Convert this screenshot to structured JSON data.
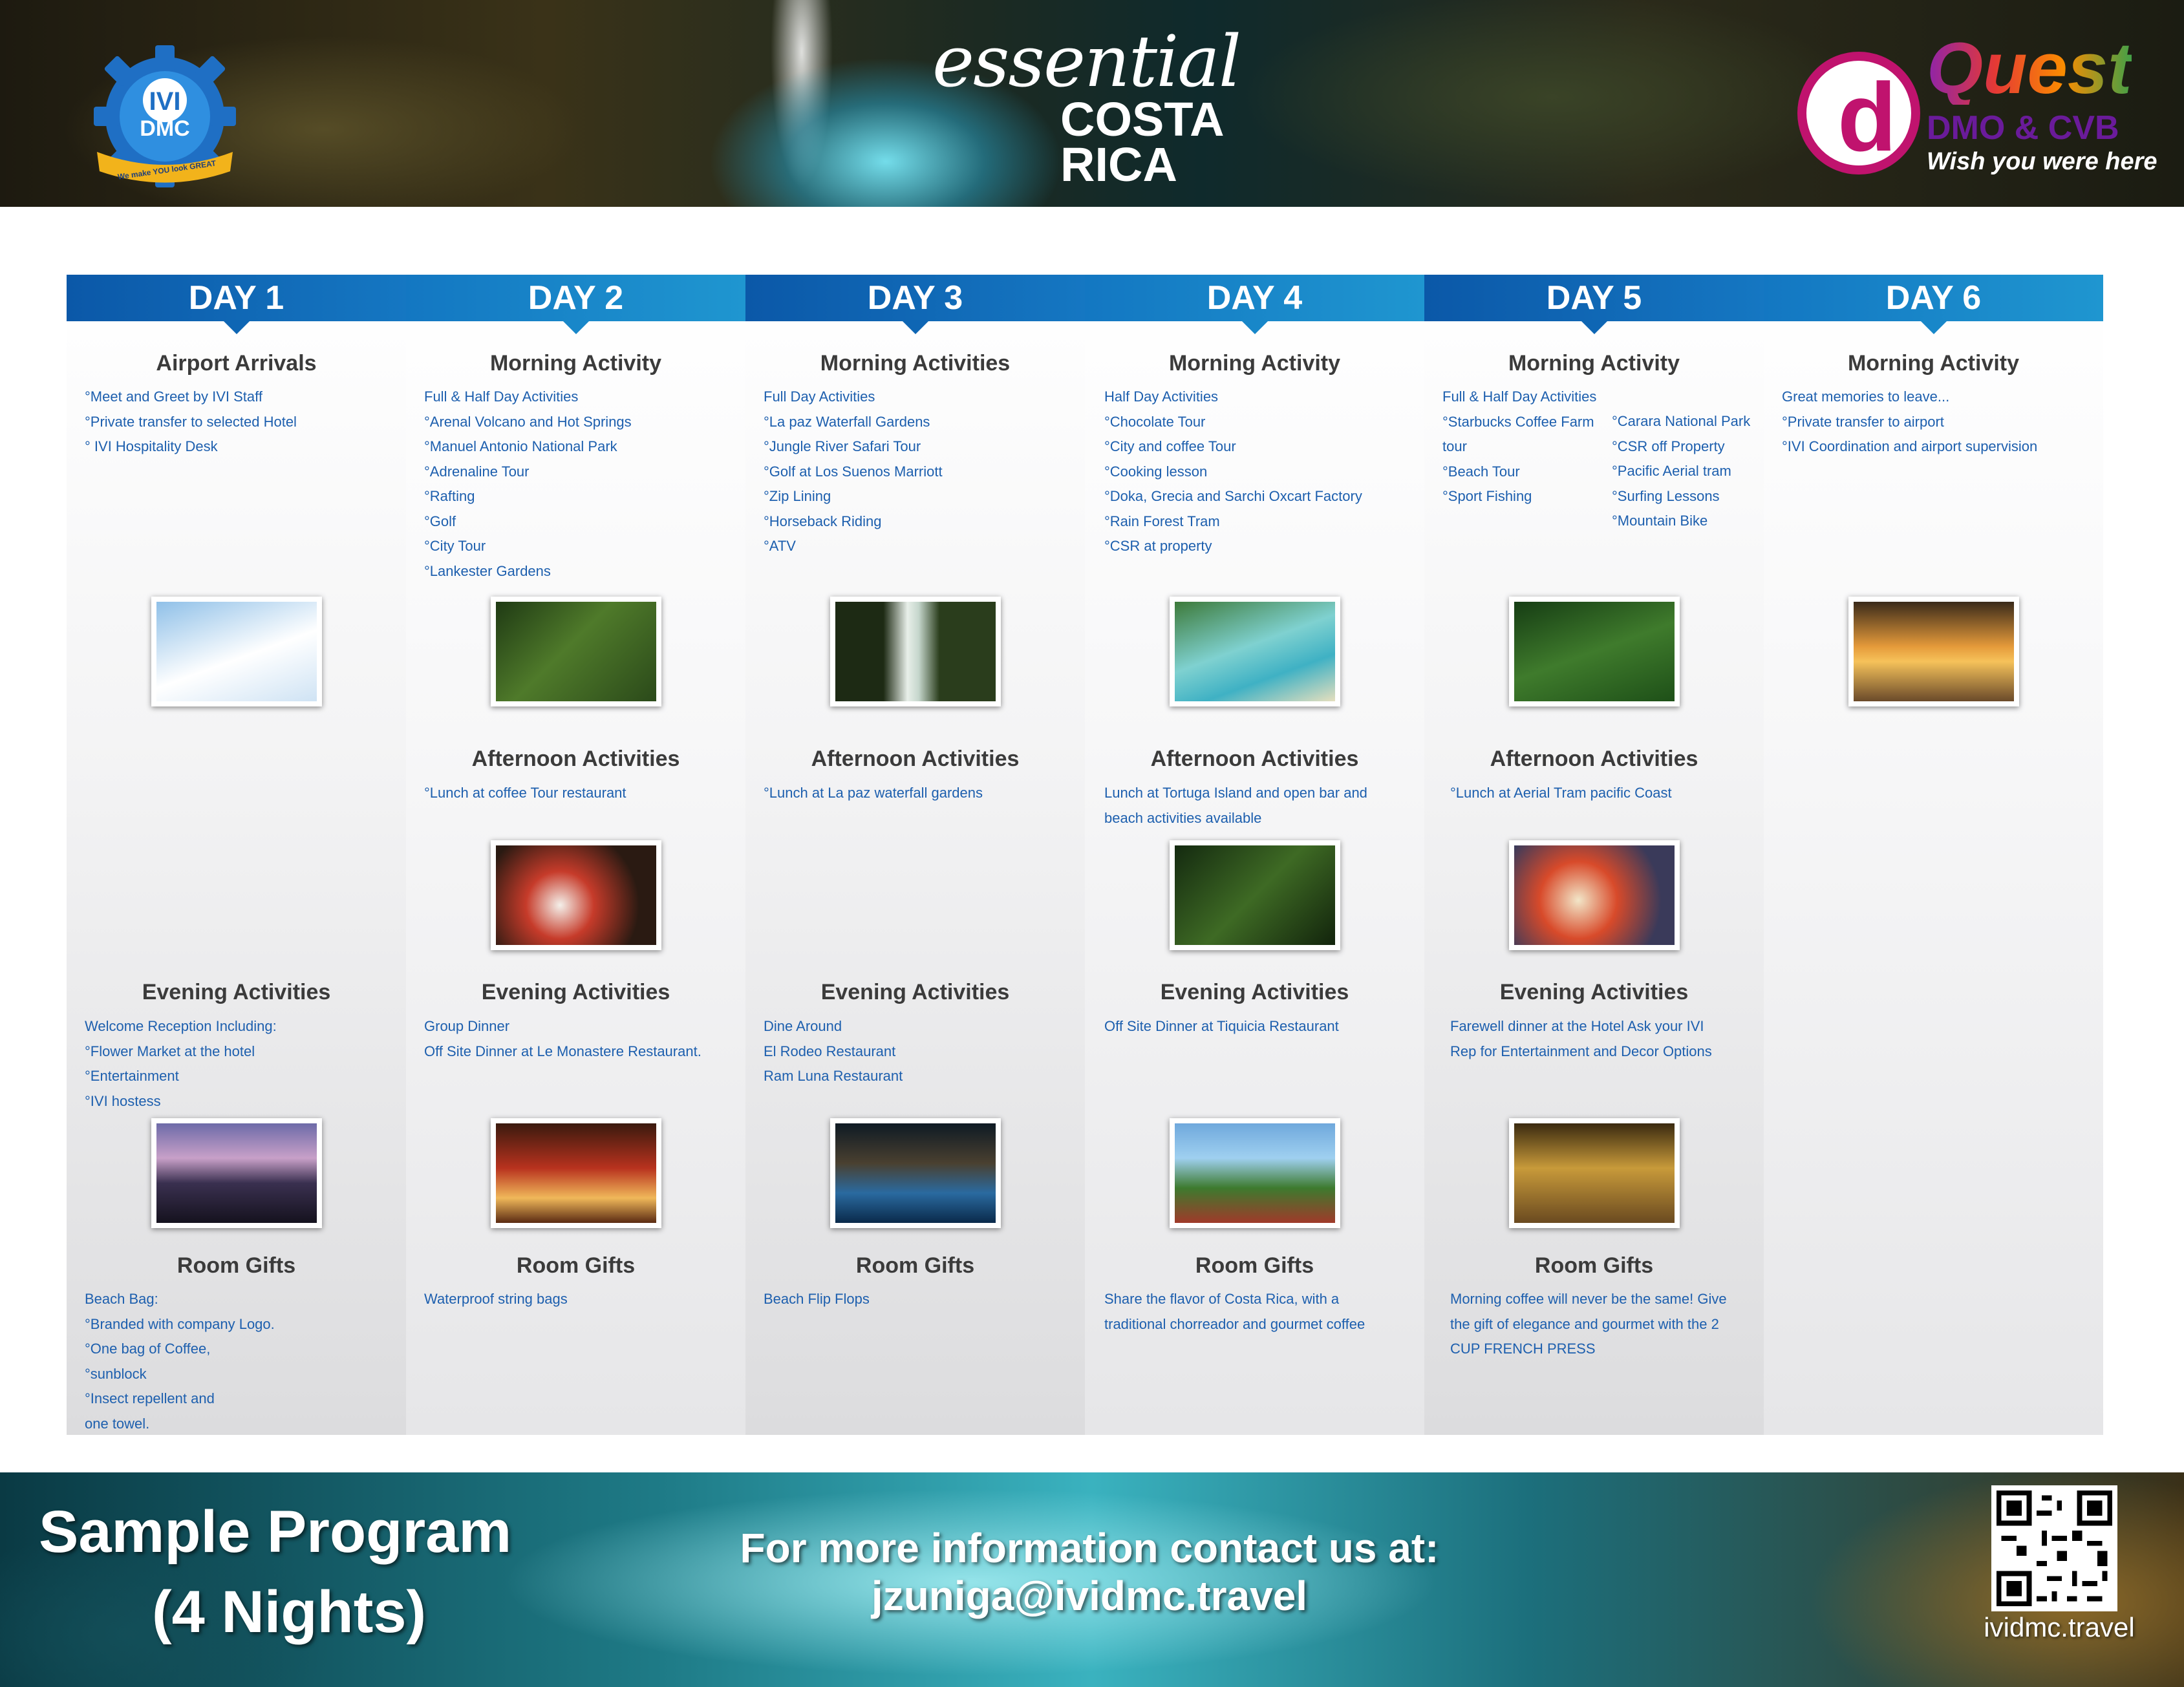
{
  "header": {
    "ivi_logo": {
      "name": "DMC",
      "tagline": "We make YOU look GREAT"
    },
    "brand": {
      "script": "essential",
      "line1": "COSTA",
      "line2": "RICA"
    },
    "quest_logo": {
      "word": "Quest",
      "sub": "DMO & CVB",
      "tagline": "Wish you were here"
    }
  },
  "colors": {
    "day_blue_dark": "#0b58a8",
    "day_blue_light": "#1f96d0",
    "item_text": "#1d5fae",
    "section_title": "#3b3b3b"
  },
  "days": [
    {
      "label": "DAY 1",
      "morning_title": "Airport Arrivals",
      "morning_items": [
        "°Meet and Greet by IVI Staff",
        "°Private transfer to selected Hotel",
        "° IVI Hospitality Desk"
      ],
      "morning_photo": "airplane-in-clouds",
      "afternoon_title": "",
      "afternoon_items": [],
      "afternoon_photo": "",
      "evening_title": "Evening Activities",
      "evening_items": [
        "Welcome Reception Including:",
        "°Flower Market at the hotel",
        "°Entertainment",
        "°IVI hostess"
      ],
      "evening_photo": "city-at-night",
      "gifts_title": "Room Gifts",
      "gifts_items": [
        "Beach Bag:",
        "°Branded with company Logo.",
        "°One bag of Coffee,",
        "°sunblock",
        "°Insect repellent and",
        "one towel."
      ]
    },
    {
      "label": "DAY 2",
      "morning_title": "Morning Activity",
      "morning_items": [
        "Full & Half Day Activities",
        "°Arenal Volcano and Hot Springs",
        "°Manuel Antonio National Park",
        "°Adrenaline Tour",
        "°Rafting",
        "°Golf",
        "°City Tour",
        "°Lankester Gardens"
      ],
      "morning_photo": "garden-tour",
      "afternoon_title": "Afternoon Activities",
      "afternoon_items": [
        "°Lunch at coffee Tour restaurant"
      ],
      "afternoon_photo": "lunch-plates",
      "evening_title": "Evening Activities",
      "evening_items": [
        "Group Dinner",
        "Off Site Dinner at Le Monastere Restaurant."
      ],
      "evening_photo": "restaurant-interior",
      "gifts_title": "Room Gifts",
      "gifts_items": [
        "Waterproof string bags"
      ]
    },
    {
      "label": "DAY 3",
      "morning_title": "Morning Activities",
      "morning_items": [
        "Full Day Activities",
        "°La paz Waterfall Gardens",
        "°Jungle River Safari Tour",
        "°Golf at Los Suenos Marriott",
        "°Zip Lining",
        "°Horseback Riding",
        "°ATV"
      ],
      "morning_photo": "waterfall",
      "afternoon_title": "Afternoon Activities",
      "afternoon_items": [
        "°Lunch at La paz waterfall gardens"
      ],
      "afternoon_photo": "",
      "evening_title": "Evening Activities",
      "evening_items": [
        "Dine Around",
        "El Rodeo Restaurant",
        "Ram Luna Restaurant"
      ],
      "evening_photo": "pool-at-night",
      "gifts_title": "Room Gifts",
      "gifts_items": [
        "Beach Flip Flops"
      ]
    },
    {
      "label": "DAY 4",
      "morning_title": "Morning Activity",
      "morning_items": [
        "Half Day Activities",
        "°Chocolate Tour",
        "°City and coffee Tour",
        "°Cooking lesson",
        "°Doka, Grecia and Sarchi Oxcart Factory",
        "°Rain Forest Tram",
        "°CSR at property"
      ],
      "morning_photo": "beach-aerial",
      "afternoon_title": "Afternoon Activities",
      "afternoon_items": [
        "Lunch at Tortuga Island and open bar and",
        "beach activities available"
      ],
      "afternoon_photo": "zip-line",
      "evening_title": "Evening Activities",
      "evening_items": [
        "Off Site Dinner at Tiquicia Restaurant"
      ],
      "evening_photo": "palm-resort",
      "gifts_title": "Room Gifts",
      "gifts_items": [
        "Share the flavor of Costa Rica, with a",
        "traditional chorreador and gourmet coffee"
      ]
    },
    {
      "label": "DAY 5",
      "morning_title": "Morning Activity",
      "morning_items": [
        "Full & Half Day Activities",
        "°Starbucks Coffee Farm",
        "tour",
        "°Beach Tour",
        "°Sport Fishing"
      ],
      "morning_items_b": [
        "°Carara National Park",
        "°CSR off Property",
        "°Pacific Aerial tram",
        "°Surfing Lessons",
        "°Mountain Bike"
      ],
      "morning_photo": "aerial-tram",
      "afternoon_title": "Afternoon Activities",
      "afternoon_items": [
        "°Lunch at Aerial Tram pacific Coast"
      ],
      "afternoon_photo": "fruit-buffet",
      "evening_title": "Evening Activities",
      "evening_items": [
        "Farewell dinner  at the Hotel  Ask your IVI",
        "Rep for Entertainment and Decor Options"
      ],
      "evening_photo": "banquet-hall",
      "gifts_title": "Room Gifts",
      "gifts_items": [
        "Morning coffee will never be the same! Give",
        "the gift of elegance and gourmet with the 2",
        "CUP FRENCH PRESS"
      ]
    },
    {
      "label": "DAY 6",
      "morning_title": "Morning Activity",
      "morning_items": [
        "Great memories to leave...",
        "°Private transfer to airport",
        "°IVI Coordination and airport supervision"
      ],
      "morning_photo": "plane-at-sunset",
      "afternoon_title": "",
      "afternoon_items": [],
      "afternoon_photo": "",
      "evening_title": "",
      "evening_items": [],
      "evening_photo": "",
      "gifts_title": "",
      "gifts_items": []
    }
  ],
  "footer": {
    "sample_line1": "Sample Program",
    "sample_line2": "(4 Nights)",
    "contact_line1": "For more information contact us at:",
    "contact_email": "jzuniga@ividmc.travel",
    "qr_icon": "qr-code-icon",
    "website": "ividmc.travel"
  }
}
